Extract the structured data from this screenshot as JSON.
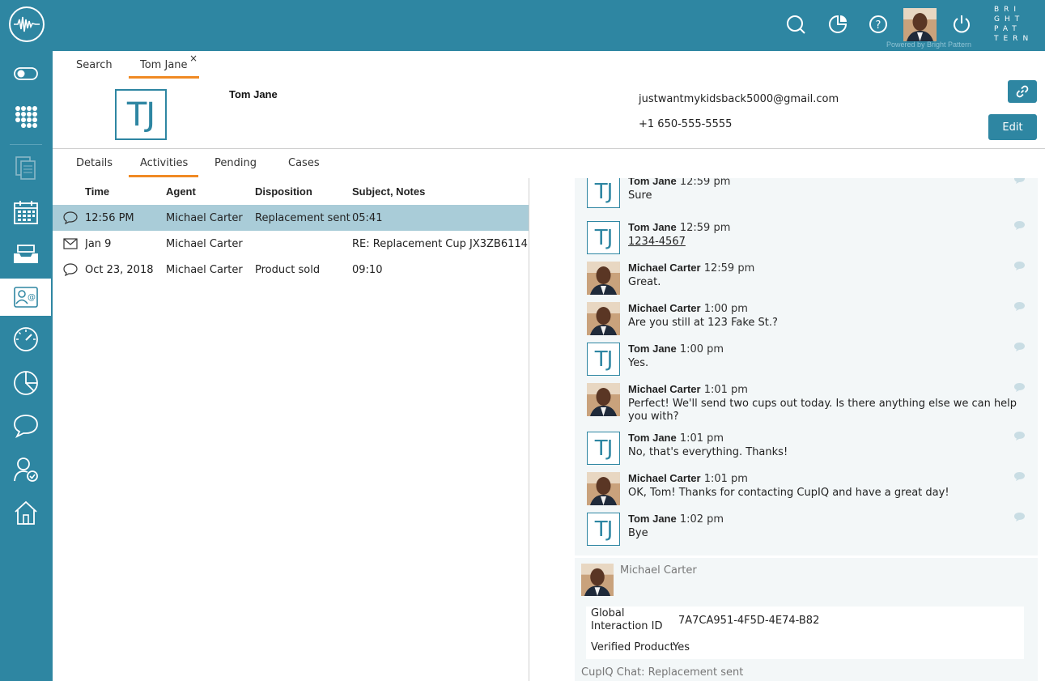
{
  "topbar": {
    "powered_by": "Powered by Bright Pattern",
    "brand_lines": [
      "BRI",
      "GHT",
      "PAT",
      "TERN"
    ],
    "icons": [
      "search-icon",
      "reports-icon",
      "help-icon",
      "user-avatar",
      "power-icon"
    ]
  },
  "sidebar": {
    "items": [
      "toggle-icon",
      "dialpad-icon",
      "documents-icon",
      "calendar-icon",
      "inbox-icon",
      "contacts-icon",
      "dashboard-icon",
      "piechart-icon",
      "chat-icon",
      "user-check-icon",
      "home-icon"
    ],
    "active": "contacts-icon"
  },
  "tabs": {
    "search": "Search",
    "contact": "Tom Jane",
    "close": "×"
  },
  "contact": {
    "initials": "TJ",
    "name": "Tom Jane",
    "email": "justwantmykidsback5000@gmail.com",
    "phone": "+1 650-555-5555",
    "edit_label": "Edit"
  },
  "subtabs": [
    "Details",
    "Activities",
    "Pending",
    "Cases"
  ],
  "activities": {
    "columns": [
      "Time",
      "Agent",
      "Disposition",
      "Subject, Notes"
    ],
    "rows": [
      {
        "icon": "chat-icon",
        "time": "12:56 PM",
        "agent": "Michael Carter",
        "disposition": "Replacement sent",
        "subject": "05:41"
      },
      {
        "icon": "email-icon",
        "time": "Jan 9",
        "agent": "Michael Carter",
        "disposition": "",
        "subject": "RE: Replacement Cup JX3ZB6114..."
      },
      {
        "icon": "chat-icon",
        "time": "Oct 23, 2018",
        "agent": "Michael Carter",
        "disposition": "Product sold",
        "subject": "09:10"
      }
    ]
  },
  "chat": {
    "messages": [
      {
        "sender": "Tom Jane",
        "time": "12:59 pm",
        "text": "Sure"
      },
      {
        "sender": "Tom Jane",
        "time": "12:59 pm",
        "text": "1234-4567"
      },
      {
        "sender": "Michael Carter",
        "time": "12:59 pm",
        "text": "Great."
      },
      {
        "sender": "Michael Carter",
        "time": "1:00 pm",
        "text": "Are you still at 123 Fake St.?"
      },
      {
        "sender": "Tom Jane",
        "time": "1:00 pm",
        "text": "Yes."
      },
      {
        "sender": "Michael Carter",
        "time": "1:01 pm",
        "text": "Perfect! We'll send two cups out today. Is there anything else we can help you with?"
      },
      {
        "sender": "Tom Jane",
        "time": "1:01 pm",
        "text": "No, that's everything. Thanks!"
      },
      {
        "sender": "Michael Carter",
        "time": "1:01 pm",
        "text": "OK, Tom! Thanks for contacting CupIQ and have a great day!"
      },
      {
        "sender": "Tom Jane",
        "time": "1:02 pm",
        "text": "Bye"
      }
    ]
  },
  "footer": {
    "agent": "Michael Carter",
    "global_id_label": "Global Interaction ID",
    "global_id": "7A7CA951-4F5D-4E74-B82",
    "verified_label": "Verified Product",
    "verified": "Yes",
    "disposition": "CupIQ Chat: Replacement sent"
  },
  "colors": {
    "primary": "#2e86a2",
    "accent": "#f08a24",
    "selected_row": "#a9ccd8"
  }
}
